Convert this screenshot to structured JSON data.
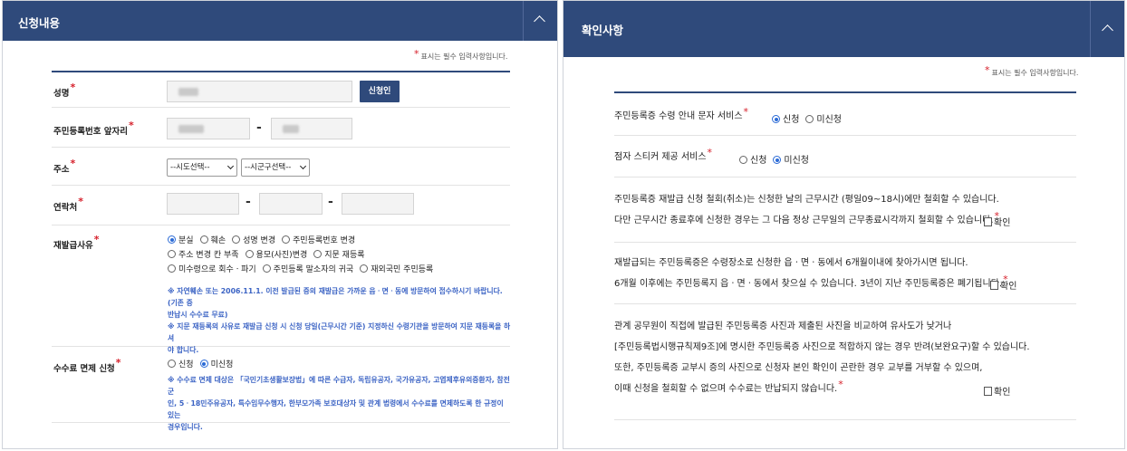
{
  "left": {
    "title": "신청내용",
    "required_note": "표시는 필수 입력사항입니다.",
    "name": {
      "label": "성명",
      "button": "신청인"
    },
    "rrn": {
      "label": "주민등록번호 앞자리",
      "separator": "-"
    },
    "address": {
      "label": "주소",
      "sido": "--시도선택--",
      "sigungu": "--시군구선택--"
    },
    "phone": {
      "label": "연락처",
      "separator": "-"
    },
    "reason": {
      "label": "재발급사유",
      "options": [
        [
          "분실",
          "훼손",
          "성명 변경",
          "주민등록번호 변경"
        ],
        [
          "주소 변경 칸 부족",
          "용모(사진)변경",
          "지문 재등록"
        ],
        [
          "미수령으로 회수ㆍ파기",
          "주민등록 말소자의 귀국",
          "재외국민 주민등록"
        ]
      ],
      "notes": [
        "※ 자연훼손 또는 2006.11.1. 이전 발급된 증의 재발급은 가까운 읍ㆍ면ㆍ동에 방문하여 접수하시기 바랍니다.(기존 증",
        "반납시 수수료 무료)",
        "※ 지문 재등록의 사유로 재발급 신청 시 신청 당일(근무시간 기준) 지정하신 수령기관을 방문하여 지문 재등록을 하셔",
        "야 합니다."
      ]
    },
    "fee": {
      "label": "수수료 면제 신청",
      "options": [
        "신청",
        "미신청"
      ],
      "notes": [
        "※ 수수료 면제 대상은 「국민기초생활보장법」에 따른 수급자, 독립유공자, 국가유공자, 고엽제후유의증환자, 참전군",
        "인, 5ㆍ18민주유공자, 특수임무수행자, 한부모가족 보호대상자 및 관계 법령에서 수수료를 면제하도록 한 규정이 있는",
        "경우입니다."
      ]
    }
  },
  "right": {
    "title": "확인사항",
    "required_note": "표시는 필수 입력사항입니다.",
    "sms": {
      "label": "주민등록증 수령 안내 문자 서비스",
      "options": [
        "신청",
        "미신청"
      ]
    },
    "braille": {
      "label": "점자 스티커 제공 서비스",
      "options": [
        "신청",
        "미신청"
      ]
    },
    "confirm_label": "확인",
    "notice1": [
      "주민등록증 재발급 신청 철회(취소)는 신청한 날의 근무시간 (평일09~18시)에만 철회할 수 있습니다.",
      "다만 근무시간 종료후에 신청한 경우는 그 다음 정상 근무일의 근무종료시각까지 철회할 수 있습니다."
    ],
    "notice2": [
      "재발급되는 주민등록증은 수령장소로 신청한 읍ㆍ면ㆍ동에서 6개월이내에 찾아가시면 됩니다.",
      "6개월 이후에는 주민등록지 읍ㆍ면ㆍ동에서 찾으실 수 있습니다. 3년이 지난 주민등록증은 폐기됩니다."
    ],
    "notice3": [
      "관계 공무원이 직접에 발급된 주민등록증 사진과 제출된 사진을 비교하여 유사도가 낮거나",
      "[주민등록법시행규칙제9조]에 명시한 주민등록증 사진으로 적합하지 않는 경우 반려(보완요구)할 수 있습니다.",
      "또한, 주민등록증 교부시 증의 사진으로 신청자 본인 확인이 곤란한 경우 교부를 거부할 수 있으며,",
      "이때 신청을 철회할 수 없으며 수수료는 반납되지 않습니다."
    ]
  }
}
